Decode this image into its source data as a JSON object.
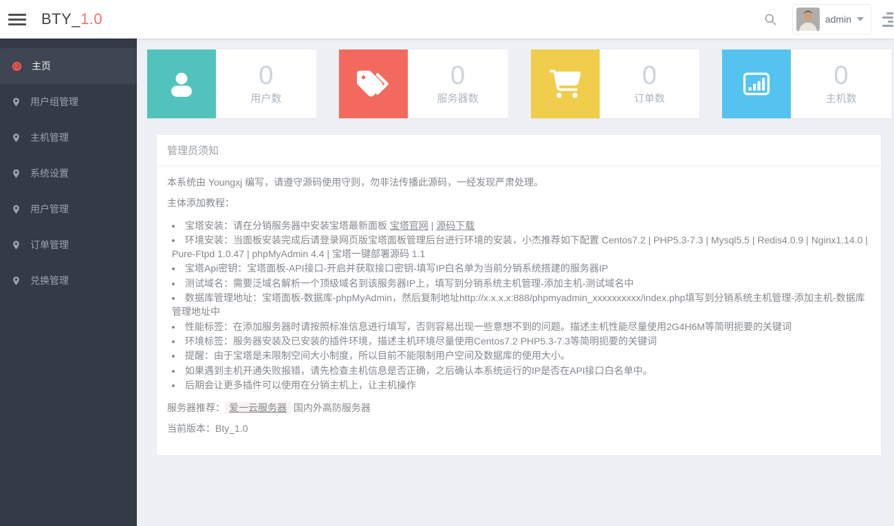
{
  "header": {
    "menu_icon": "hamburger-menu-icon",
    "logo_text": "BTY_",
    "logo_version": "1.0",
    "logo_version_color": "#f2706d",
    "search_icon": "search-icon",
    "user": {
      "name": "admin",
      "avatar_icon": "user-avatar-photo",
      "caret_icon": "caret-down-icon"
    },
    "right_icon": "activity-bars-icon"
  },
  "sidebar": {
    "items": [
      {
        "label": "主页",
        "icon": "dashboard-icon",
        "active": true
      },
      {
        "label": "用户组管理",
        "icon": "pin-icon",
        "active": false
      },
      {
        "label": "主机管理",
        "icon": "pin-icon",
        "active": false
      },
      {
        "label": "系统设置",
        "icon": "pin-icon",
        "active": false
      },
      {
        "label": "用户管理",
        "icon": "pin-icon",
        "active": false
      },
      {
        "label": "订单管理",
        "icon": "pin-icon",
        "active": false
      },
      {
        "label": "兑换管理",
        "icon": "pin-icon",
        "active": false
      }
    ]
  },
  "stats": [
    {
      "value": "0",
      "label": "用户数",
      "color": "#52c3bc",
      "icon": "user-icon"
    },
    {
      "value": "0",
      "label": "服务器数",
      "color": "#f4695d",
      "icon": "tags-icon"
    },
    {
      "value": "0",
      "label": "订单数",
      "color": "#f0cd4b",
      "icon": "cart-icon"
    },
    {
      "value": "0",
      "label": "主机数",
      "color": "#54c3ef",
      "icon": "bar-chart-icon"
    }
  ],
  "panel": {
    "title": "管理员须知",
    "intro": "本系统由 Youngxj 编写，请遵守源码使用守则，勿非法传播此源码，一经发现严肃处理。",
    "tutorial_heading": "主体添加教程：",
    "bullet1": {
      "prefix": "宝塔安装：请在分销服务器中安装宝塔最新面板 ",
      "link1": "宝塔官网",
      "separator": " | ",
      "link2": "源码下载"
    },
    "bullets": [
      "环境安装：当面板安装完成后请登录网页版宝塔面板管理后台进行环境的安装，小杰推荐如下配置 Centos7.2 | PHP5.3-7.3 | Mysql5.5 | Redis4.0.9 | Nginx1.14.0 | Pure-Ftpd 1.0.47 | phpMyAdmin 4.4 | 宝塔一键部署源码 1.1",
      "宝塔Api密钥：宝塔面板-API接口-开启并获取接口密钥-填写IP白名单为当前分销系统搭建的服务器IP",
      "测试域名：需要泛域名解析一个顶级域名到该服务器IP上，填写到分销系统主机管理-添加主机-测试域名中",
      "数据库管理地址：宝塔面板-数据库-phpMyAdmin，然后复制地址http://x.x.x.x:888/phpmyadmin_xxxxxxxxxx/index.php填写到分销系统主机管理-添加主机-数据库管理地址中",
      "性能标签：在添加服务器时请按照标准信息进行填写，否则容易出现一些意想不到的问题。描述主机性能尽量使用2G4H6M等简明扼要的关键词",
      "环境标签：服务器安装及已安装的插件环境，描述主机环境尽量使用Centos7.2 PHP5.3-7.3等简明扼要的关键词",
      "提醒：由于宝塔是未限制空间大小制度，所以目前不能限制用户空间及数据库的使用大小。",
      "如果遇到主机开通失败报错，请先检查主机信息是否正确，之后确认本系统运行的IP是否在API接口白名单中。",
      "后期会让更多插件可以使用在分销主机上，让主机操作"
    ],
    "recommend": {
      "label": "服务器推荐：",
      "link": "爱一云服务器",
      "suffix": "国内外高防服务器"
    },
    "version": {
      "label": "当前版本：",
      "value": "Bty_1.0"
    }
  }
}
